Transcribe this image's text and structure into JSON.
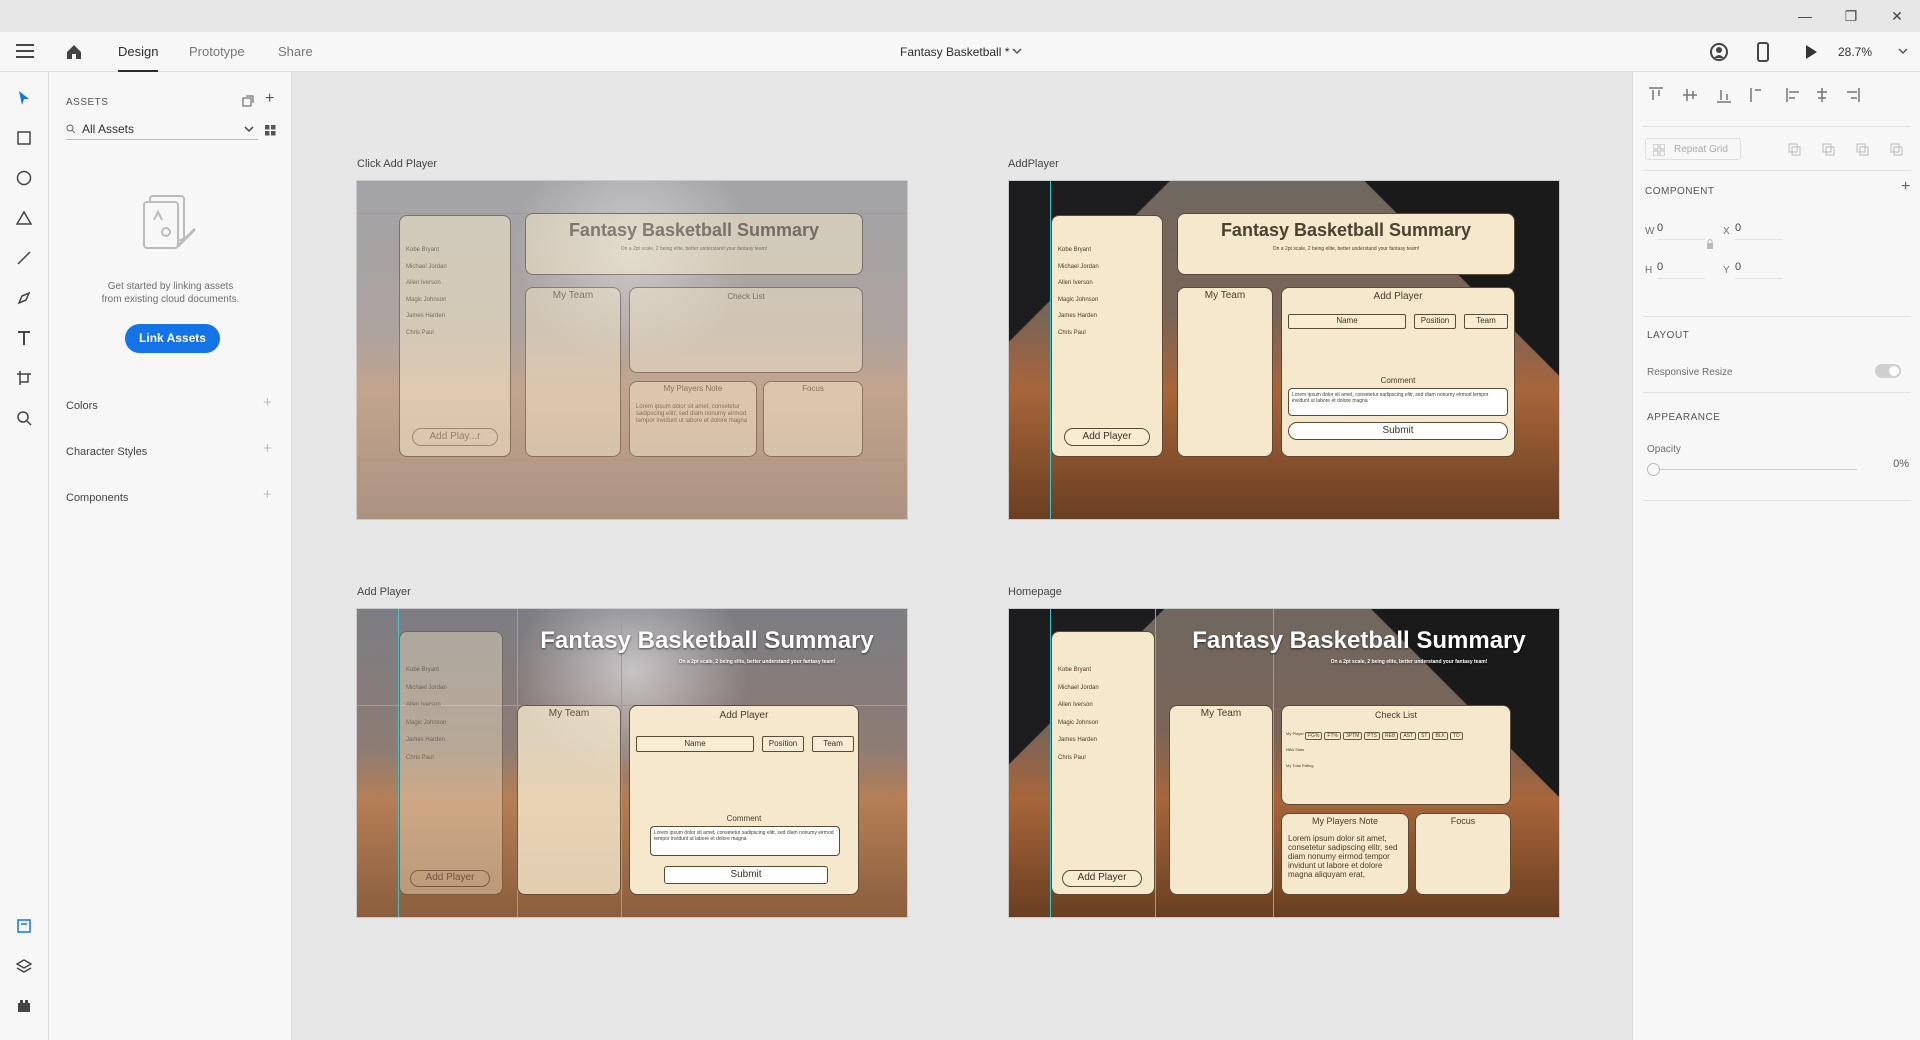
{
  "window": {
    "minimize": "—",
    "restore": "❐",
    "close": "✕"
  },
  "menubar": {
    "tabs": [
      {
        "label": "Design"
      },
      {
        "label": "Prototype"
      },
      {
        "label": "Share"
      }
    ],
    "doc_title": "Fantasy Basketball *",
    "zoom": "28.7%"
  },
  "assets": {
    "header": "ASSETS",
    "filter": "All Assets",
    "empty_text_1": "Get started by linking assets",
    "empty_text_2": "from existing cloud documents.",
    "link_button": "Link Assets",
    "sections": [
      {
        "label": "Colors"
      },
      {
        "label": "Character Styles"
      },
      {
        "label": "Components"
      }
    ]
  },
  "artboards": [
    {
      "label": "Click Add Player"
    },
    {
      "label": "AddPlayer"
    },
    {
      "label": "Add Player"
    },
    {
      "label": "Homepage"
    }
  ],
  "mock": {
    "title": "Fantasy Basketball Summary",
    "subtitle": "On a 2pt scale, 2 being elite, better understand your fantasy team!",
    "players": [
      "Kobe Bryant",
      "Michael Jordan",
      "Allen Iverson",
      "Magic Johnson",
      "James Harden",
      "Chris Paul"
    ],
    "add_player": "Add Player",
    "add_player_faded": "Add Play...r",
    "my_team": "My Team",
    "check_list": "Check List",
    "players_note": "My Players Note",
    "focus": "Focus",
    "lorem": "Lorem ipsum dolor sit amet, consetetur sadipscing elitr, sed diam nonumy eirmod tempor invidunt ut labore et dolore magna aliquyam erat,",
    "lorem_short": "Lorem ipsum dolor sit amet, consetetur sadipscing elitr, sed diam nonumy eirmod tempor invidunt ut labore et dolore magna",
    "name": "Name",
    "position": "Position",
    "team": "Team",
    "comment": "Comment",
    "submit": "Submit",
    "stats": [
      "FG%",
      "FT%",
      "3PTM",
      "PTS",
      "REB",
      "AST",
      "ST",
      "BLK",
      "TO"
    ],
    "row_labels": [
      "My Player Rating",
      "NBA Stats",
      "My Total Rating"
    ]
  },
  "properties": {
    "repeat_grid": "Repeat Grid",
    "component": "COMPONENT",
    "w_label": "W",
    "w_value": "0",
    "x_label": "X",
    "x_value": "0",
    "h_label": "H",
    "h_value": "0",
    "y_label": "Y",
    "y_value": "0",
    "layout": "LAYOUT",
    "responsive": "Responsive Resize",
    "appearance": "APPEARANCE",
    "opacity_label": "Opacity",
    "opacity_value": "0%"
  },
  "colors": {
    "accent": "#1473e6",
    "guide": "#37c7d4"
  }
}
